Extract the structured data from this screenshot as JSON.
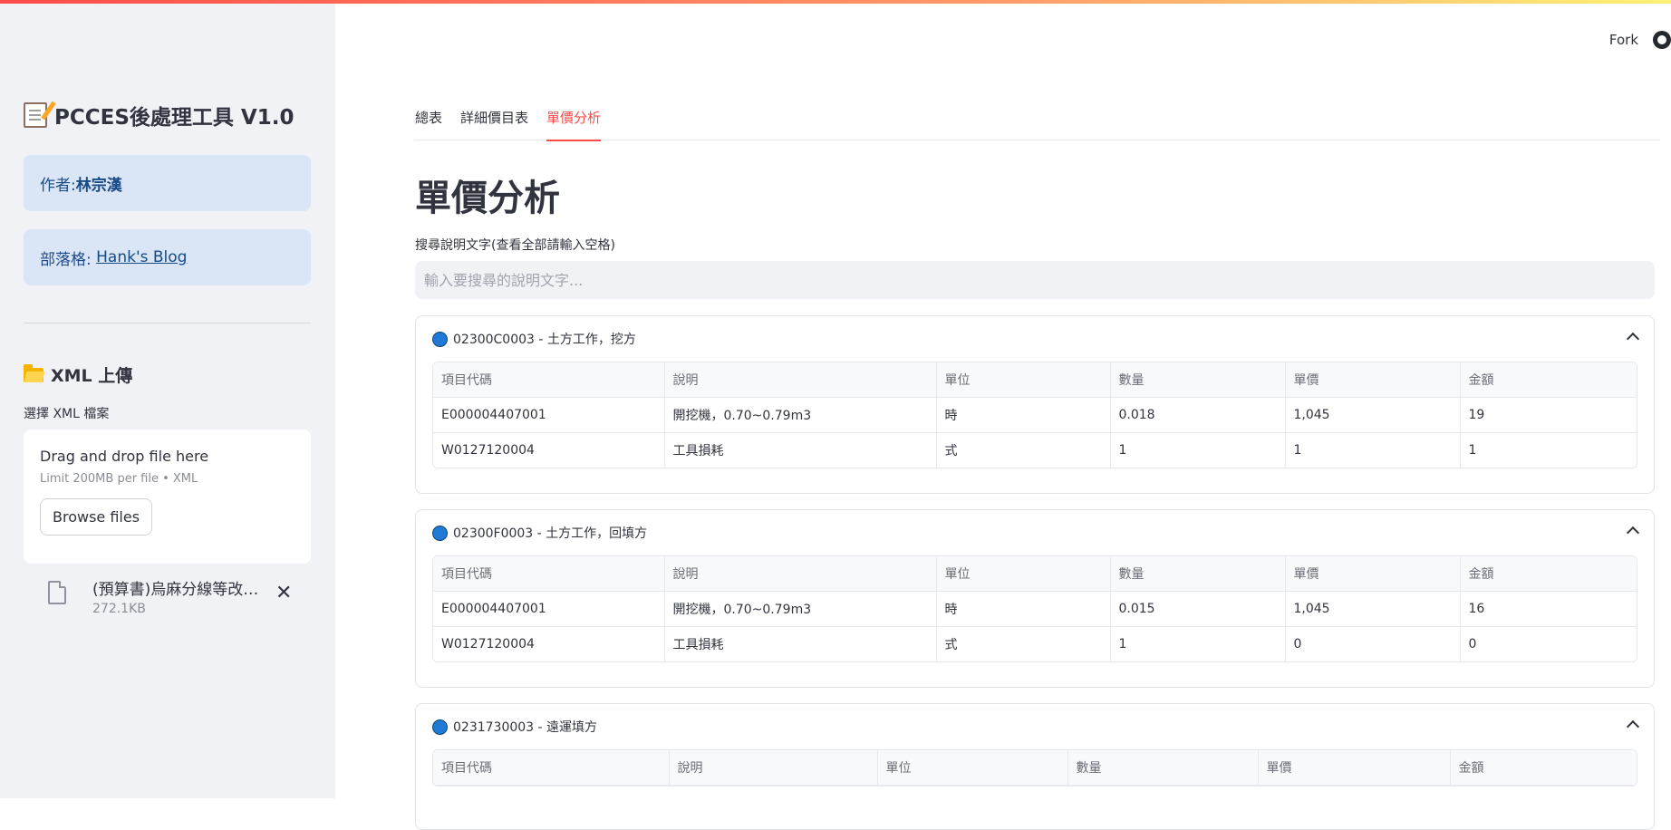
{
  "sidebar": {
    "title": "PCCES後處理工具 V1.0",
    "author_prefix": "作者:",
    "author_name": "林宗漢",
    "blog_prefix": "部落格: ",
    "blog_link": "Hank's Blog",
    "upload_heading": "XML 上傳",
    "upload_label": "選擇 XML 檔案",
    "dropzone_title": "Drag and drop file here",
    "dropzone_limit": "Limit 200MB per file • XML",
    "browse_label": "Browse files",
    "file_name": "(預算書)烏麻分線等改善工程.xml",
    "file_size": "272.1KB"
  },
  "header": {
    "fork_label": "Fork"
  },
  "tabs": [
    {
      "label": "總表"
    },
    {
      "label": "詳細價目表"
    },
    {
      "label": "單價分析"
    }
  ],
  "page": {
    "title": "單價分析",
    "search_label": "搜尋說明文字(查看全部請輸入空格)",
    "search_placeholder": "輸入要搜尋的說明文字...",
    "search_value": ""
  },
  "columns": [
    "項目代碼",
    "說明",
    "單位",
    "數量",
    "單價",
    "金額"
  ],
  "expanders": [
    {
      "title": "02300C0003 - 土方工作，挖方",
      "rows": [
        [
          "E000004407001",
          "開挖機，0.70~0.79m3",
          "時",
          "0.018",
          "1,045",
          "19"
        ],
        [
          "W0127120004",
          "工具損耗",
          "式",
          "1",
          "1",
          "1"
        ]
      ]
    },
    {
      "title": "02300F0003 - 土方工作，回填方",
      "rows": [
        [
          "E000004407001",
          "開挖機，0.70~0.79m3",
          "時",
          "0.015",
          "1,045",
          "16"
        ],
        [
          "W0127120004",
          "工具損耗",
          "式",
          "1",
          "0",
          "0"
        ]
      ]
    },
    {
      "title": "0231730003 - 遠運填方",
      "rows": []
    }
  ],
  "colors": {
    "accent": "#ff4b4b",
    "sidebar_bg": "#f0f2f6",
    "info_bg": "#dae6f5",
    "dot_blue": "#1f7ad6"
  }
}
